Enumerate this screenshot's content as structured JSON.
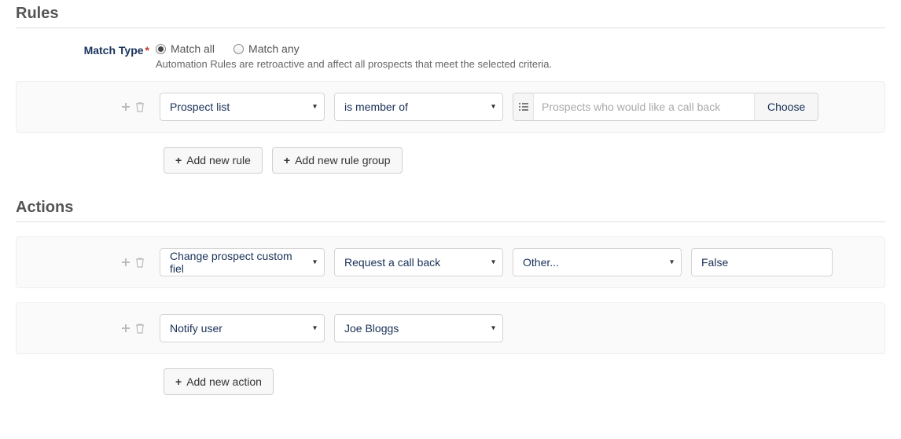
{
  "rules": {
    "section_title": "Rules",
    "match_type_label": "Match Type",
    "radio_all": "Match all",
    "radio_any": "Match any",
    "helper": "Automation Rules are retroactive and affect all prospects that meet the selected criteria.",
    "rule1": {
      "field": "Prospect list",
      "operator": "is member of",
      "lookup_placeholder": "Prospects who would like a call back",
      "choose": "Choose"
    },
    "add_rule_btn": "Add new rule",
    "add_group_btn": "Add new rule group"
  },
  "actions": {
    "section_title": "Actions",
    "action1": {
      "type": "Change prospect custom fiel",
      "field": "Request a call back",
      "operator": "Other...",
      "value": "False"
    },
    "action2": {
      "type": "Notify user",
      "value": "Joe Bloggs"
    },
    "add_action_btn": "Add new action"
  }
}
